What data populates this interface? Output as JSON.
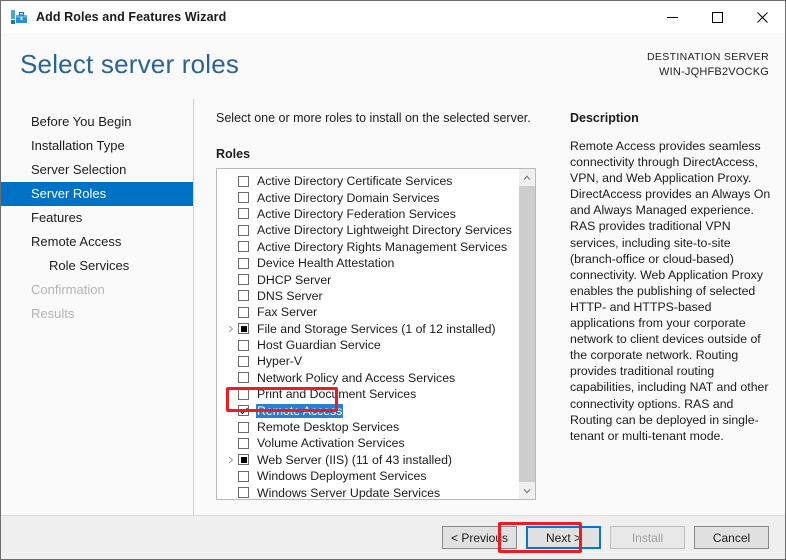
{
  "window": {
    "title": "Add Roles and Features Wizard",
    "icon": "toolbox-icon",
    "minimize_label": "Minimize",
    "maximize_label": "Maximize",
    "close_label": "Close"
  },
  "header": {
    "page_title": "Select server roles",
    "destination_label": "DESTINATION SERVER",
    "destination_server": "WIN-JQHFB2VOCKG"
  },
  "sidebar": {
    "items": [
      {
        "label": "Before You Begin",
        "state": "normal",
        "sub": false
      },
      {
        "label": "Installation Type",
        "state": "normal",
        "sub": false
      },
      {
        "label": "Server Selection",
        "state": "normal",
        "sub": false
      },
      {
        "label": "Server Roles",
        "state": "selected",
        "sub": false
      },
      {
        "label": "Features",
        "state": "normal",
        "sub": false
      },
      {
        "label": "Remote Access",
        "state": "normal",
        "sub": false
      },
      {
        "label": "Role Services",
        "state": "normal",
        "sub": true
      },
      {
        "label": "Confirmation",
        "state": "disabled",
        "sub": false
      },
      {
        "label": "Results",
        "state": "disabled",
        "sub": false
      }
    ]
  },
  "main": {
    "instruction": "Select one or more roles to install on the selected server.",
    "roles_label": "Roles",
    "roles": [
      {
        "label": "Active Directory Certificate Services",
        "checkbox": "unchecked",
        "expandable": false,
        "selected": false
      },
      {
        "label": "Active Directory Domain Services",
        "checkbox": "unchecked",
        "expandable": false,
        "selected": false
      },
      {
        "label": "Active Directory Federation Services",
        "checkbox": "unchecked",
        "expandable": false,
        "selected": false
      },
      {
        "label": "Active Directory Lightweight Directory Services",
        "checkbox": "unchecked",
        "expandable": false,
        "selected": false
      },
      {
        "label": "Active Directory Rights Management Services",
        "checkbox": "unchecked",
        "expandable": false,
        "selected": false
      },
      {
        "label": "Device Health Attestation",
        "checkbox": "unchecked",
        "expandable": false,
        "selected": false
      },
      {
        "label": "DHCP Server",
        "checkbox": "unchecked",
        "expandable": false,
        "selected": false
      },
      {
        "label": "DNS Server",
        "checkbox": "unchecked",
        "expandable": false,
        "selected": false
      },
      {
        "label": "Fax Server",
        "checkbox": "unchecked",
        "expandable": false,
        "selected": false
      },
      {
        "label": "File and Storage Services (1 of 12 installed)",
        "checkbox": "partial",
        "expandable": true,
        "selected": false
      },
      {
        "label": "Host Guardian Service",
        "checkbox": "unchecked",
        "expandable": false,
        "selected": false
      },
      {
        "label": "Hyper-V",
        "checkbox": "unchecked",
        "expandable": false,
        "selected": false
      },
      {
        "label": "Network Policy and Access Services",
        "checkbox": "unchecked",
        "expandable": false,
        "selected": false
      },
      {
        "label": "Print and Document Services",
        "checkbox": "unchecked",
        "expandable": false,
        "selected": false
      },
      {
        "label": "Remote Access",
        "checkbox": "checked",
        "expandable": false,
        "selected": true
      },
      {
        "label": "Remote Desktop Services",
        "checkbox": "unchecked",
        "expandable": false,
        "selected": false
      },
      {
        "label": "Volume Activation Services",
        "checkbox": "unchecked",
        "expandable": false,
        "selected": false
      },
      {
        "label": "Web Server (IIS) (11 of 43 installed)",
        "checkbox": "partial",
        "expandable": true,
        "selected": false
      },
      {
        "label": "Windows Deployment Services",
        "checkbox": "unchecked",
        "expandable": false,
        "selected": false
      },
      {
        "label": "Windows Server Update Services",
        "checkbox": "unchecked",
        "expandable": false,
        "selected": false
      }
    ],
    "scrollbar": {
      "up_arrow": "chevron-up-icon",
      "down_arrow": "chevron-down-icon"
    }
  },
  "description": {
    "title": "Description",
    "text": "Remote Access provides seamless connectivity through DirectAccess, VPN, and Web Application Proxy. DirectAccess provides an Always On and Always Managed experience. RAS provides traditional VPN services, including site-to-site (branch-office or cloud-based) connectivity. Web Application Proxy enables the publishing of selected HTTP- and HTTPS-based applications from your corporate network to client devices outside of the corporate network. Routing provides traditional routing capabilities, including NAT and other connectivity options. RAS and Routing can be deployed in single-tenant or multi-tenant mode."
  },
  "footer": {
    "previous_label": "< Previous",
    "next_label": "Next >",
    "install_label": "Install",
    "cancel_label": "Cancel"
  },
  "annotations": {
    "color": "#ed1c24",
    "items": [
      "remote-access-role-row",
      "next-button"
    ]
  },
  "colors": {
    "accent_blue": "#0072c6",
    "title_blue": "#2a6496",
    "selection_blue": "#2a7fd4",
    "annotation_red": "#ed1c24",
    "footer_gray": "#efefef"
  }
}
